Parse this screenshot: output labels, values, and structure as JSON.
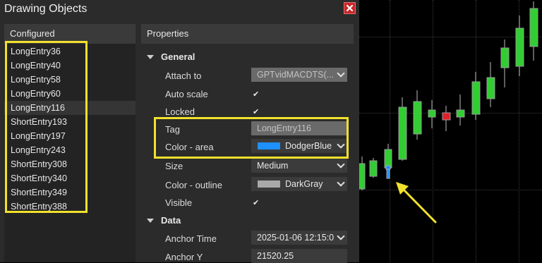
{
  "dialog": {
    "title": "Drawing Objects",
    "close_label": "×"
  },
  "left_panel": {
    "header": "Configured",
    "items": [
      "LongEntry36",
      "LongEntry40",
      "LongEntry58",
      "LongEntry60",
      "LongEntry116",
      "ShortEntry193",
      "LongEntry197",
      "LongEntry243",
      "ShortEntry308",
      "ShortEntry340",
      "ShortEntry349",
      "ShortEntry388"
    ],
    "selected_item": "LongEntry116"
  },
  "right_panel": {
    "header": "Properties",
    "general": {
      "title": "General",
      "attach_to_label": "Attach to",
      "attach_to_value": "GPTvidMACDTS(...",
      "auto_scale_label": "Auto scale",
      "auto_scale_checked": "✔",
      "locked_label": "Locked",
      "locked_checked": "✔",
      "tag_label": "Tag",
      "tag_value": "LongEntry116",
      "color_area_label": "Color - area",
      "color_area_value": "DodgerBlue",
      "color_area_swatch": "#1e90ff",
      "size_label": "Size",
      "size_value": "Medium",
      "color_outline_label": "Color - outline",
      "color_outline_value": "DarkGray",
      "color_outline_swatch": "#a9a9a9",
      "visible_label": "Visible",
      "visible_checked": "✔"
    },
    "data": {
      "title": "Data",
      "anchor_time_label": "Anchor Time",
      "anchor_time_value": "2025-01-06 12:15:0",
      "anchor_y_label": "Anchor Y",
      "anchor_y_value": "21520.25"
    }
  },
  "annotation": {
    "highlight_color": "#f2e12c"
  },
  "chart": {
    "up_color": "#32cd32",
    "down_color": "#e0202a",
    "marker_color": "#1e90ff"
  }
}
